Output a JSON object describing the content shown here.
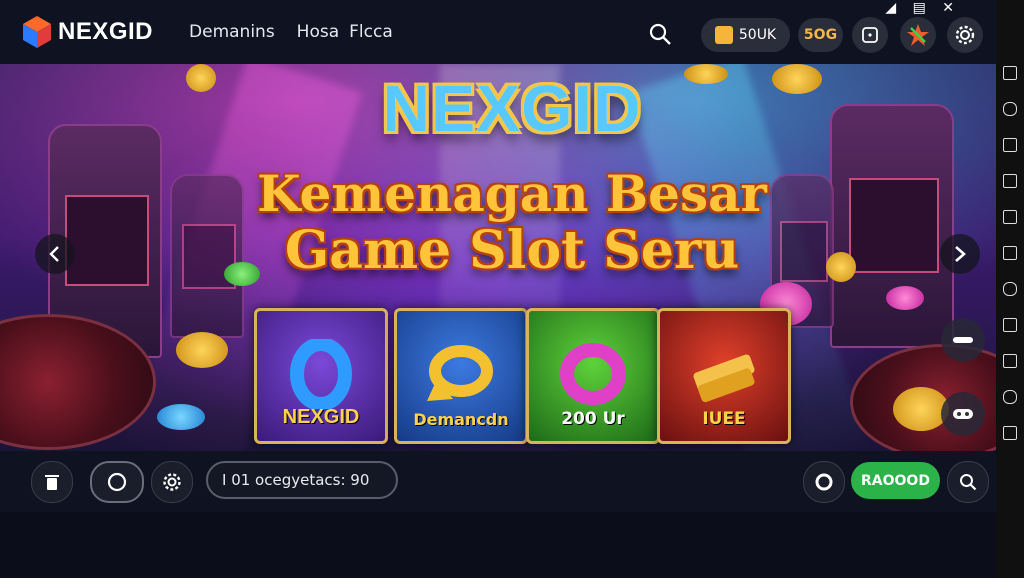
{
  "brand": {
    "name": "NEXGID"
  },
  "nav": {
    "items": [
      "Demanins",
      "Hosa",
      "Flcca"
    ]
  },
  "header": {
    "balance_label": "50UK",
    "coins_label": "5OG",
    "system_icons": "◢ ▤ ✕"
  },
  "banner": {
    "title": "NEXGID",
    "subtitle_line1": "Kemenagan Besar",
    "subtitle_line2": "Game Slot Seru",
    "cards": [
      {
        "label": "NEXGID",
        "color": "#2f9bff"
      },
      {
        "label": "Demancdn",
        "color": "#f3c030"
      },
      {
        "label": "200 Ur",
        "color": "#e040c8"
      },
      {
        "label": "IUEE",
        "color": "#f4c24a"
      }
    ]
  },
  "bottom": {
    "input_value": "I 01 ocegyetacs: 90",
    "action_label": "RAOOOD"
  },
  "colors": {
    "accent_green": "#2bb34a",
    "gold": "#ffc43a",
    "topbar": "#0f1220"
  }
}
